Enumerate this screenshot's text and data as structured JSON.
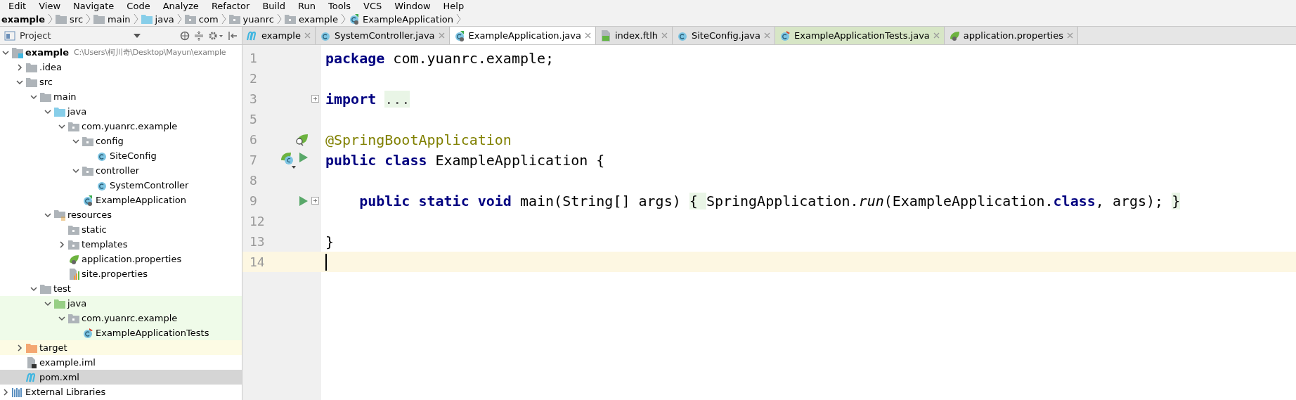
{
  "menu": [
    "Edit",
    "View",
    "Navigate",
    "Code",
    "Analyze",
    "Refactor",
    "Build",
    "Run",
    "Tools",
    "VCS",
    "Window",
    "Help"
  ],
  "breadcrumb": [
    {
      "label": "example",
      "kind": "module"
    },
    {
      "label": "src",
      "kind": "folder"
    },
    {
      "label": "main",
      "kind": "folder"
    },
    {
      "label": "java",
      "kind": "source"
    },
    {
      "label": "com",
      "kind": "package"
    },
    {
      "label": "yuanrc",
      "kind": "package"
    },
    {
      "label": "example",
      "kind": "package"
    },
    {
      "label": "ExampleApplication",
      "kind": "spring-class"
    }
  ],
  "project_panel": {
    "title": "Project"
  },
  "tree": [
    {
      "label": "example",
      "kind": "module",
      "detail": "C:\\Users\\柯川奇\\Desktop\\Mayun\\example",
      "expanded": true,
      "selected": false,
      "children": [
        {
          "label": ".idea",
          "kind": "folder",
          "expanded": false,
          "selected": false
        },
        {
          "label": "src",
          "kind": "folder",
          "expanded": true,
          "selected": false,
          "children": [
            {
              "label": "main",
              "kind": "folder",
              "expanded": true,
              "selected": false,
              "children": [
                {
                  "label": "java",
                  "kind": "source",
                  "expanded": true,
                  "selected": false,
                  "children": [
                    {
                      "label": "com.yuanrc.example",
                      "kind": "package",
                      "expanded": true,
                      "selected": false,
                      "children": [
                        {
                          "label": "config",
                          "kind": "package",
                          "expanded": true,
                          "selected": false,
                          "children": [
                            {
                              "label": "SiteConfig",
                              "kind": "class",
                              "selected": false
                            }
                          ]
                        },
                        {
                          "label": "controller",
                          "kind": "package",
                          "expanded": true,
                          "selected": false,
                          "children": [
                            {
                              "label": "SystemController",
                              "kind": "class",
                              "selected": false
                            }
                          ]
                        },
                        {
                          "label": "ExampleApplication",
                          "kind": "spring-class",
                          "selected": false
                        }
                      ]
                    }
                  ]
                },
                {
                  "label": "resources",
                  "kind": "resources",
                  "expanded": true,
                  "selected": false,
                  "children": [
                    {
                      "label": "static",
                      "kind": "package",
                      "selected": false
                    },
                    {
                      "label": "templates",
                      "kind": "package",
                      "expanded": false,
                      "selected": false
                    },
                    {
                      "label": "application.properties",
                      "kind": "spring-props",
                      "selected": false
                    },
                    {
                      "label": "site.properties",
                      "kind": "props",
                      "selected": false
                    }
                  ]
                }
              ]
            },
            {
              "label": "test",
              "kind": "folder",
              "expanded": true,
              "selected": false,
              "children": [
                {
                  "label": "java",
                  "kind": "test-source",
                  "test": true,
                  "expanded": true,
                  "selected": false,
                  "children": [
                    {
                      "label": "com.yuanrc.example",
                      "kind": "package",
                      "test": true,
                      "expanded": true,
                      "selected": false,
                      "children": [
                        {
                          "label": "ExampleApplicationTests",
                          "kind": "test-class",
                          "test": true,
                          "selected": false
                        }
                      ]
                    }
                  ]
                }
              ]
            }
          ]
        },
        {
          "label": "target",
          "kind": "excluded",
          "expanded": false,
          "selected": false
        },
        {
          "label": "example.iml",
          "kind": "iml",
          "selected": false
        },
        {
          "label": "pom.xml",
          "kind": "maven",
          "selected": true
        }
      ]
    },
    {
      "label": "External Libraries",
      "kind": "libraries",
      "expanded": false,
      "selected": false
    }
  ],
  "tabs": [
    {
      "label": "example",
      "kind": "maven",
      "selected": false
    },
    {
      "label": "SystemController.java",
      "kind": "class",
      "selected": false
    },
    {
      "label": "ExampleApplication.java",
      "kind": "spring-class",
      "selected": true
    },
    {
      "label": "index.ftlh",
      "kind": "template",
      "selected": false
    },
    {
      "label": "SiteConfig.java",
      "kind": "class",
      "selected": false
    },
    {
      "label": "ExampleApplicationTests.java",
      "kind": "test-class",
      "test": true,
      "selected": false
    },
    {
      "label": "application.properties",
      "kind": "spring-props",
      "selected": false
    }
  ],
  "editor": {
    "lines": [
      {
        "number": "1",
        "tokens": [
          {
            "text": "package",
            "kind": "keyword"
          },
          {
            "text": " com.yuanrc.example;",
            "kind": "plain"
          }
        ]
      },
      {
        "number": "2"
      },
      {
        "number": "3",
        "fold": true,
        "tokens": [
          {
            "text": "import",
            "kind": "keyword"
          },
          {
            "text": "...",
            "kind": "folded"
          }
        ]
      },
      {
        "number": "5"
      },
      {
        "number": "6",
        "gutter": [
          {
            "kind": "spring-bean"
          }
        ],
        "tokens": [
          {
            "text": "@SpringBootApplication",
            "kind": "annotation"
          }
        ]
      },
      {
        "number": "7",
        "gutter": [
          {
            "kind": "spring-class"
          },
          {
            "kind": "run"
          }
        ],
        "tokens": [
          {
            "text": "public class",
            "kind": "keyword"
          },
          {
            "text": " ExampleApplication {",
            "kind": "plain"
          }
        ]
      },
      {
        "number": "8"
      },
      {
        "number": "9",
        "gutter": [
          {
            "kind": "run"
          }
        ],
        "fold": true,
        "tokens": [
          {
            "text": "    public static void",
            "kind": "keyword"
          },
          {
            "text": " main(String[] args) ",
            "kind": "plain"
          },
          {
            "text": "{ ",
            "kind": "folded-brace"
          },
          {
            "text": "SpringApplication.",
            "kind": "plain"
          },
          {
            "text": "run",
            "kind": "italic"
          },
          {
            "text": "(ExampleApplication.",
            "kind": "plain"
          },
          {
            "text": "class",
            "kind": "keyword"
          },
          {
            "text": ", args); ",
            "kind": "plain"
          },
          {
            "text": "}",
            "kind": "folded-brace"
          }
        ]
      },
      {
        "number": "12"
      },
      {
        "number": "13",
        "tokens": [
          {
            "text": "}",
            "kind": "plain"
          }
        ]
      },
      {
        "number": "14",
        "current": true
      }
    ]
  }
}
